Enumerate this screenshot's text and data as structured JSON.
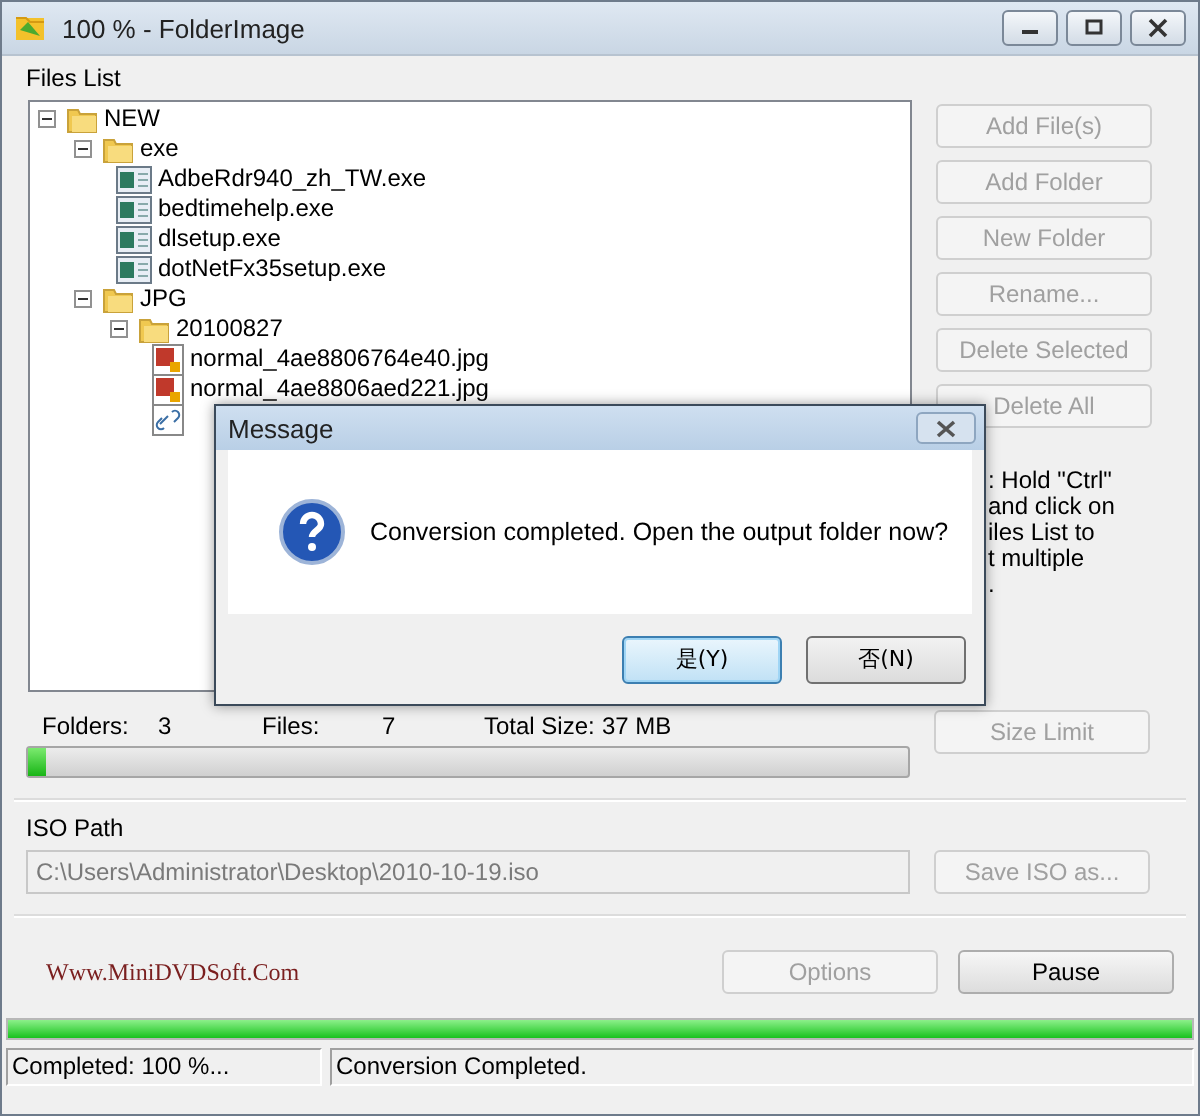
{
  "window": {
    "title": "100 % - FolderImage"
  },
  "files_list": {
    "label": "Files List",
    "tree": [
      {
        "kind": "folder",
        "label": "NEW",
        "expanded": true,
        "children": [
          {
            "kind": "folder",
            "label": "exe",
            "expanded": true,
            "children": [
              {
                "kind": "exe",
                "label": "AdbeRdr940_zh_TW.exe"
              },
              {
                "kind": "exe",
                "label": "bedtimehelp.exe"
              },
              {
                "kind": "exe",
                "label": "dlsetup.exe"
              },
              {
                "kind": "exe",
                "label": "dotNetFx35setup.exe"
              }
            ]
          },
          {
            "kind": "folder",
            "label": "JPG",
            "expanded": true,
            "children": [
              {
                "kind": "folder",
                "label": "20100827",
                "expanded": true,
                "children": [
                  {
                    "kind": "image",
                    "label": "normal_4ae8806764e40.jpg"
                  },
                  {
                    "kind": "image",
                    "label": "normal_4ae8806aed221.jpg"
                  },
                  {
                    "kind": "link"
                  }
                ]
              }
            ]
          }
        ]
      }
    ]
  },
  "side_buttons": [
    {
      "label": "Add File(s)",
      "disabled": true
    },
    {
      "label": "Add Folder",
      "disabled": true
    },
    {
      "label": "New Folder",
      "disabled": true
    },
    {
      "label": "Rename...",
      "disabled": true
    },
    {
      "label": "Delete Selected",
      "disabled": true
    },
    {
      "label": "Delete All",
      "disabled": true
    }
  ],
  "hint_lines": [
    ": Hold \"Ctrl\"",
    "and click on",
    "iles List to",
    "t multiple",
    "."
  ],
  "stats": {
    "folders_label": "Folders:",
    "folders": "3",
    "files_label": "Files:",
    "files": "7",
    "size_label": "Total Size:",
    "size": "37 MB"
  },
  "size_meter": {
    "level": 0.02
  },
  "size_limit_button": {
    "label": "Size Limit",
    "disabled": true
  },
  "iso_path": {
    "label": "ISO Path",
    "value": "C:\\Users\\Administrator\\Desktop\\2010-10-19.iso",
    "save_button": {
      "label": "Save ISO as...",
      "disabled": true
    }
  },
  "website_link": "Www.MiniDVDSoft.Com",
  "footer_buttons": [
    {
      "label": "Options",
      "disabled": true
    },
    {
      "label": "Pause",
      "disabled": false
    }
  ],
  "progress": {
    "level": 1
  },
  "status_bar": [
    "Completed: 100 %...",
    "Conversion Completed."
  ],
  "dialog": {
    "title": "Message",
    "message": "Conversion completed. Open the output folder now?",
    "buttons": [
      {
        "label": "是(Y)",
        "selected": true
      },
      {
        "label": "否(N)",
        "selected": false
      }
    ]
  }
}
